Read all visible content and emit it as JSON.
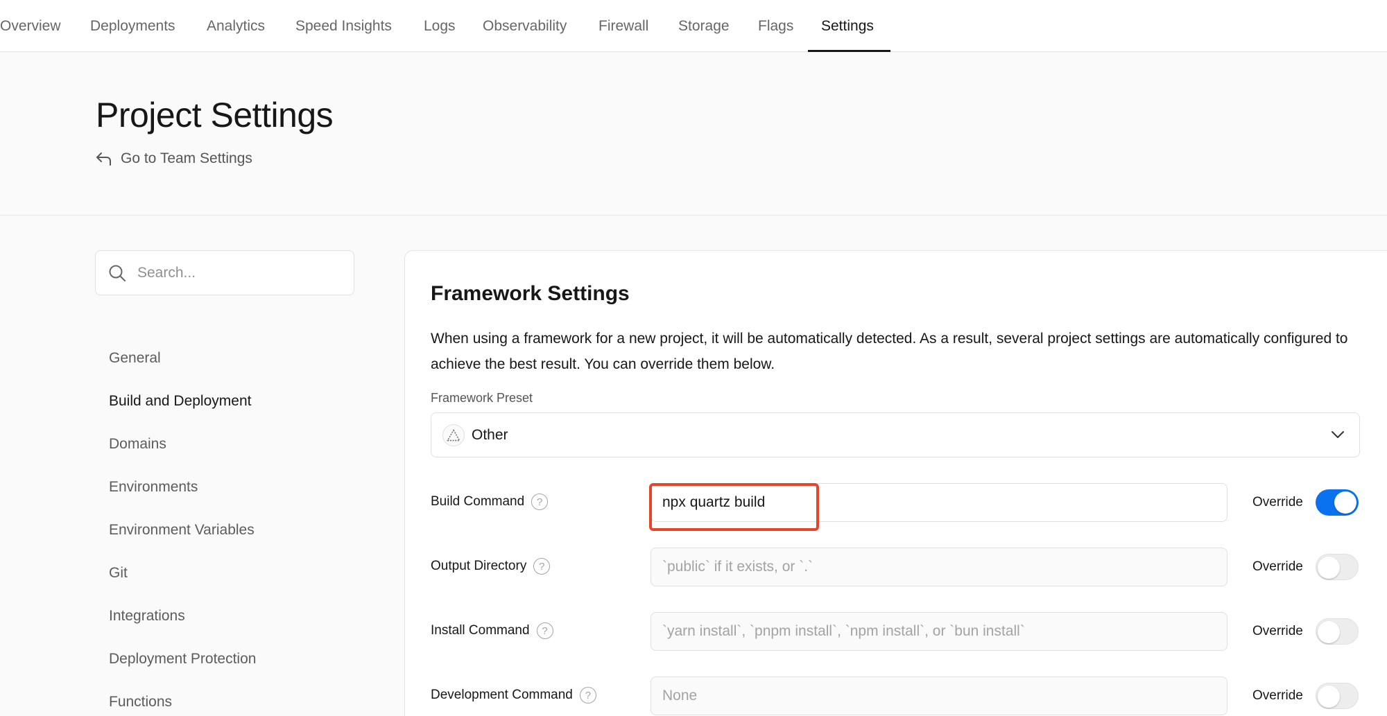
{
  "nav": {
    "tabs": [
      {
        "label": "Overview"
      },
      {
        "label": "Deployments"
      },
      {
        "label": "Analytics"
      },
      {
        "label": "Speed Insights"
      },
      {
        "label": "Logs"
      },
      {
        "label": "Observability"
      },
      {
        "label": "Firewall"
      },
      {
        "label": "Storage"
      },
      {
        "label": "Flags"
      },
      {
        "label": "Settings"
      }
    ],
    "active_tab": "Settings"
  },
  "header": {
    "title": "Project Settings",
    "back_link": "Go to Team Settings"
  },
  "sidebar": {
    "search_placeholder": "Search...",
    "items": [
      {
        "label": "General"
      },
      {
        "label": "Build and Deployment"
      },
      {
        "label": "Domains"
      },
      {
        "label": "Environments"
      },
      {
        "label": "Environment Variables"
      },
      {
        "label": "Git"
      },
      {
        "label": "Integrations"
      },
      {
        "label": "Deployment Protection"
      },
      {
        "label": "Functions"
      }
    ],
    "active_item": "Build and Deployment"
  },
  "framework": {
    "title": "Framework Settings",
    "description": "When using a framework for a new project, it will be automatically detected. As a result, several project settings are automatically configured to achieve the best result. You can override them below.",
    "preset_label": "Framework Preset",
    "preset_value": "Other",
    "rows": [
      {
        "label": "Build Command",
        "value": "npx quartz build",
        "placeholder": "",
        "override_label": "Override",
        "override": true
      },
      {
        "label": "Output Directory",
        "value": "",
        "placeholder": "`public` if it exists, or `.`",
        "override_label": "Override",
        "override": false
      },
      {
        "label": "Install Command",
        "value": "",
        "placeholder": "`yarn install`, `pnpm install`, `npm install`, or `bun install`",
        "override_label": "Override",
        "override": false
      },
      {
        "label": "Development Command",
        "value": "",
        "placeholder": "None",
        "override_label": "Override",
        "override": false
      }
    ]
  },
  "colors": {
    "accent": "#0a72ef",
    "highlight": "#e8442a"
  }
}
